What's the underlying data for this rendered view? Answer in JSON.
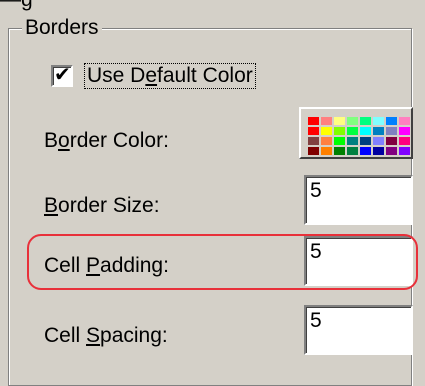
{
  "top_fragment": "—g",
  "group": {
    "title": "Borders"
  },
  "use_default_color": {
    "checked": true,
    "check_glyph": "✔",
    "label_pre": "Use D",
    "label_key": "e",
    "label_post": "fault Color"
  },
  "border_color": {
    "label_pre": "B",
    "label_key": "o",
    "label_post": "rder Color:",
    "palette": [
      "#ff0000",
      "#ff8080",
      "#ffff80",
      "#80ff80",
      "#00ff80",
      "#80ffff",
      "#0080ff",
      "#ff80c0",
      "#ff0000",
      "#ffff00",
      "#80ff00",
      "#00ff40",
      "#00ffff",
      "#0080c0",
      "#8080c0",
      "#ff00ff",
      "#804040",
      "#ff8040",
      "#00ff00",
      "#008080",
      "#004080",
      "#8080ff",
      "#800040",
      "#ff0080",
      "#800000",
      "#ff8000",
      "#008000",
      "#008040",
      "#0000ff",
      "#0000a0",
      "#800080",
      "#8000ff"
    ]
  },
  "border_size": {
    "label_key": "B",
    "label_post": "order Size:",
    "value": "5"
  },
  "cell_padding": {
    "label_pre": "Cell ",
    "label_key": "P",
    "label_post": "adding:",
    "value": "5"
  },
  "cell_spacing": {
    "label_pre": "Cell ",
    "label_key": "S",
    "label_post": "pacing:",
    "value": "5"
  },
  "highlight_color": "#e8303a"
}
